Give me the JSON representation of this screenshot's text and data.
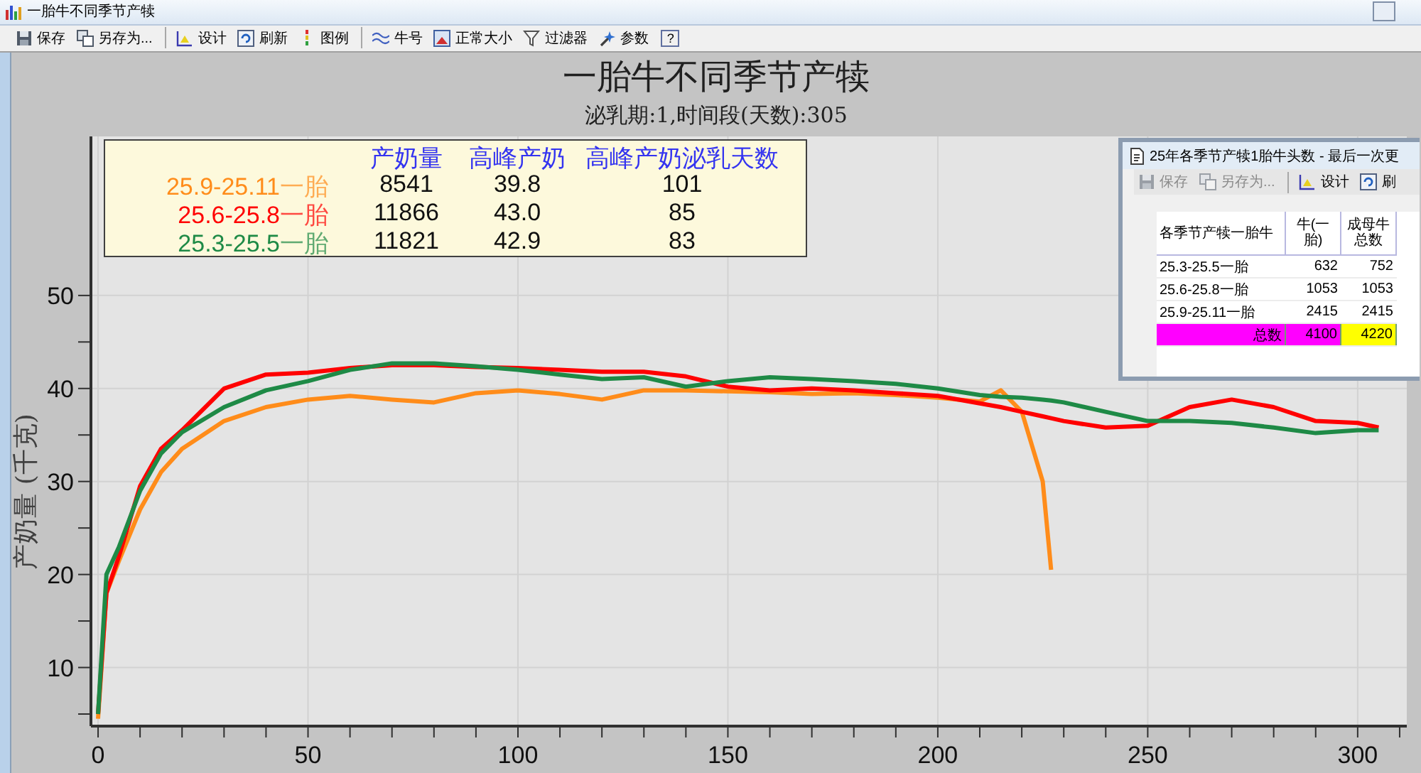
{
  "window": {
    "title": "一胎牛不同季节产犊"
  },
  "toolbar": {
    "groups": [
      [
        {
          "label": "保存"
        },
        {
          "label": "另存为..."
        }
      ],
      [
        {
          "label": "设计"
        },
        {
          "label": "刷新"
        },
        {
          "label": "图例"
        }
      ],
      [
        {
          "label": "牛号"
        },
        {
          "label": "正常大小"
        },
        {
          "label": "过滤器"
        },
        {
          "label": "参数"
        }
      ]
    ],
    "help": "?"
  },
  "chart": {
    "title": "一胎牛不同季节产犊",
    "subtitle": "泌乳期:1,时间段(天数):305",
    "legend": {
      "columns": [
        "产奶量",
        "高峰产奶",
        "高峰产奶泌乳天数"
      ],
      "rows": [
        {
          "period": "25.9-25.11",
          "parity": "一胎",
          "color": "#ff8c1a",
          "values": [
            "8541",
            "39.8",
            "101"
          ]
        },
        {
          "period": "25.6-25.8",
          "parity": "一胎",
          "color": "#ff0000",
          "values": [
            "11866",
            "43.0",
            "85"
          ]
        },
        {
          "period": "25.3-25.5",
          "parity": "一胎",
          "color": "#1e8a46",
          "values": [
            "11821",
            "42.9",
            "83"
          ]
        }
      ]
    },
    "chart_data": {
      "type": "line",
      "grid": true,
      "ylabel": "产奶量 (千克)",
      "xlim": [
        -1.7,
        311.7
      ],
      "ylim": [
        3.7,
        67.1
      ],
      "xticks": [
        0,
        50,
        100,
        150,
        200,
        250,
        300
      ],
      "yticks": [
        10,
        20,
        30,
        40,
        50
      ],
      "x": [
        0,
        2,
        5,
        10,
        15,
        20,
        30,
        40,
        50,
        60,
        70,
        80,
        90,
        100,
        110,
        120,
        130,
        140,
        150,
        160,
        170,
        180,
        190,
        200,
        210,
        215,
        220,
        225,
        227,
        230,
        240,
        250,
        260,
        270,
        280,
        290,
        300,
        305
      ],
      "series": [
        {
          "color": "#ff8c1a",
          "values": [
            4.5,
            18,
            21.5,
            27,
            31,
            33.5,
            36.5,
            38,
            38.8,
            39.2,
            38.8,
            38.5,
            39.5,
            39.8,
            39.4,
            38.8,
            39.8,
            39.8,
            39.7,
            39.6,
            39.4,
            39.5,
            39.3,
            39,
            38.6,
            39.8,
            37.5,
            30,
            20.5,
            null,
            null,
            null,
            null,
            null,
            null,
            null,
            null,
            null
          ]
        },
        {
          "color": "#ff0000",
          "values": [
            5,
            18,
            22,
            29.5,
            33.5,
            35.5,
            40,
            41.5,
            41.7,
            42.2,
            42.5,
            42.5,
            42.3,
            42.2,
            42,
            41.8,
            41.8,
            41.3,
            40.2,
            39.8,
            40,
            39.8,
            39.5,
            39.2,
            38.4,
            38,
            37.5,
            37,
            36.8,
            36.5,
            35.8,
            36,
            38,
            38.8,
            38,
            36.5,
            36.3,
            35.8
          ]
        },
        {
          "color": "#1e8a46",
          "values": [
            5,
            20,
            23,
            29,
            33,
            35.3,
            38,
            39.8,
            40.8,
            42,
            42.7,
            42.7,
            42.4,
            42,
            41.5,
            41,
            41.2,
            40.2,
            40.8,
            41.2,
            41,
            40.8,
            40.5,
            40,
            39.3,
            39.1,
            39,
            38.8,
            38.7,
            38.5,
            37.5,
            36.5,
            36.5,
            36.3,
            35.8,
            35.2,
            35.5,
            35.5
          ]
        }
      ]
    }
  },
  "inset": {
    "title": "25年各季节产犊1胎牛头数 - 最后一次更",
    "toolbar": {
      "groups": [
        [
          {
            "label": "保存",
            "disabled": true
          },
          {
            "label": "另存为...",
            "disabled": true
          }
        ],
        [
          {
            "label": "设计",
            "disabled": false
          },
          {
            "label": "刷",
            "disabled": false
          }
        ]
      ]
    },
    "table": {
      "columns": [
        "各季节产犊一胎牛",
        "牛(一胎)",
        "成母牛总数"
      ],
      "rows": [
        [
          "25.3-25.5一胎",
          "632",
          "752"
        ],
        [
          "25.6-25.8一胎",
          "1053",
          "1053"
        ],
        [
          "25.9-25.11一胎",
          "2415",
          "2415"
        ]
      ],
      "total": [
        {
          "text": "总数",
          "color": "#ff00ff"
        },
        {
          "text": "4100",
          "color": "#ff00ff"
        },
        {
          "text": "4220",
          "color": "#ffff00"
        }
      ]
    }
  }
}
